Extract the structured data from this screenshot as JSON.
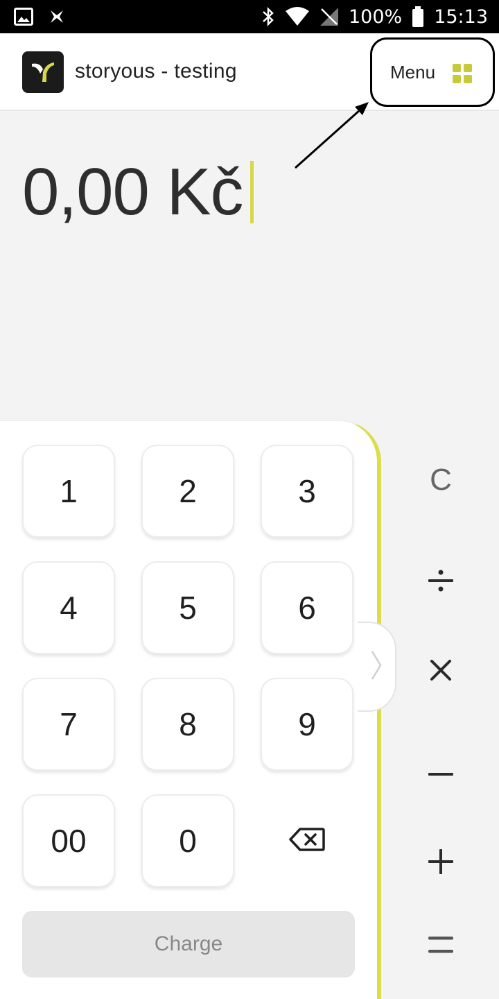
{
  "status_bar": {
    "battery": "100%",
    "time": "15:13"
  },
  "header": {
    "app_title": "storyous - testing",
    "menu_label": "Menu",
    "icons": {
      "logo": "storyous-logo-icon",
      "menu": "grid-icon"
    }
  },
  "amount": {
    "value": "0,00 Kč"
  },
  "keypad": {
    "keys": [
      "1",
      "2",
      "3",
      "4",
      "5",
      "6",
      "7",
      "8",
      "9",
      "00",
      "0"
    ],
    "backspace_icon": "backspace-icon",
    "charge_label": "Charge"
  },
  "operators": {
    "clear_label": "C",
    "icons": [
      "divide-icon",
      "multiply-icon",
      "minus-icon",
      "plus-icon",
      "equals-icon"
    ]
  },
  "colors": {
    "accent": "#d6d84a",
    "menu_grid": "#c7cb3a",
    "charge_disabled_bg": "#e6e6e6",
    "background": "#f3f3f3"
  }
}
